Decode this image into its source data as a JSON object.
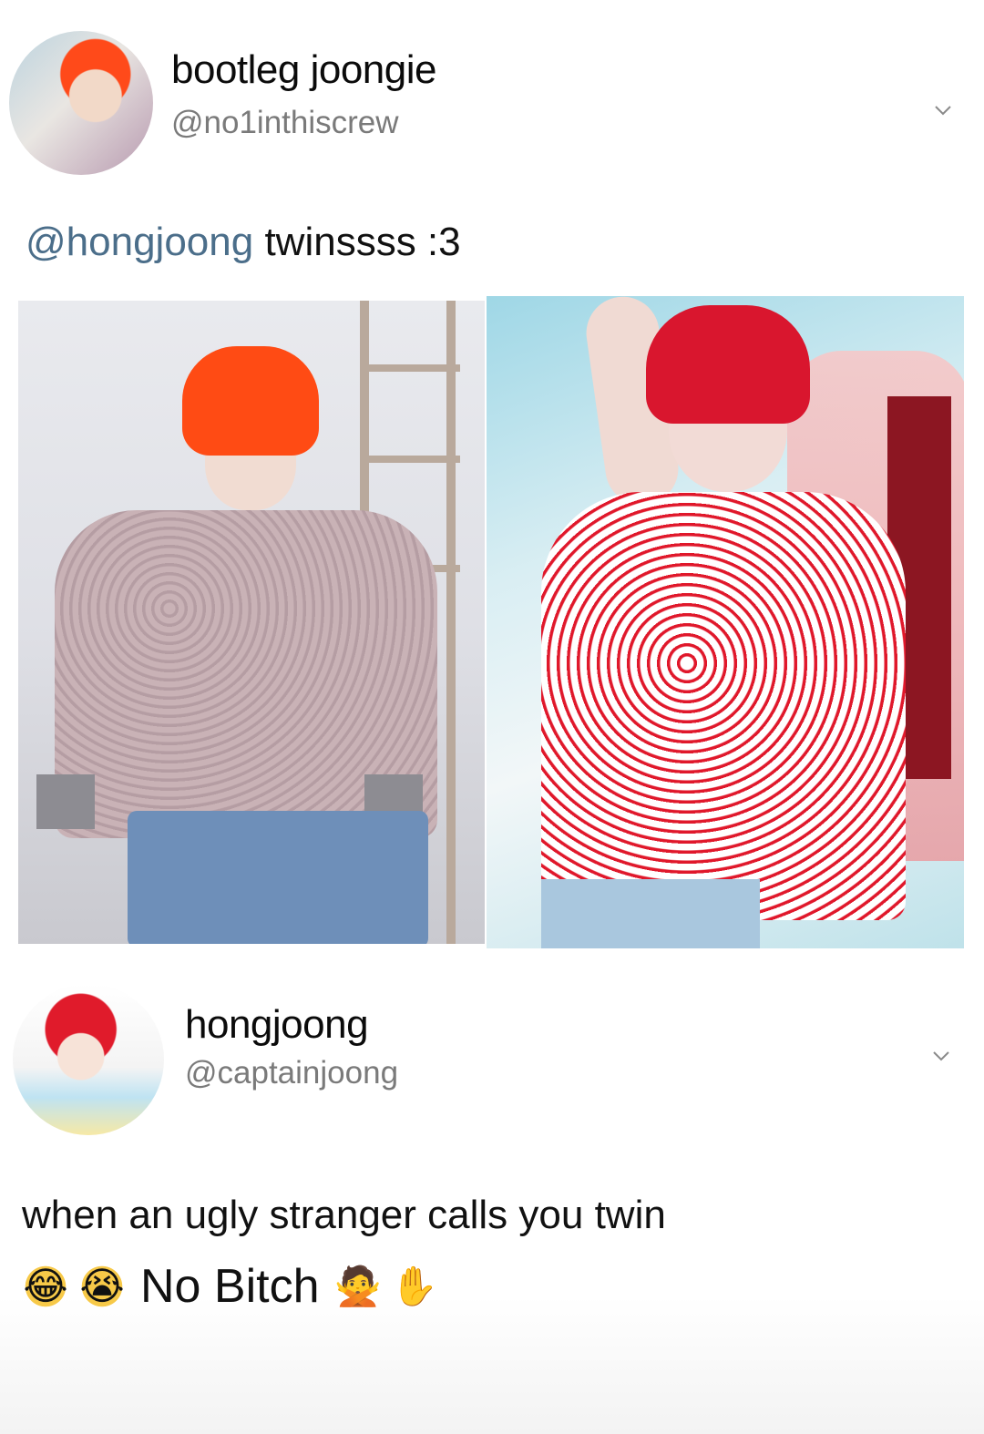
{
  "tweet1": {
    "display_name": "bootleg joongie",
    "handle": "@no1inthiscrew",
    "mention": "@hongjoong",
    "text_after_mention": " twinssss :3"
  },
  "tweet2": {
    "display_name": "hongjoong",
    "handle": "@captainjoong",
    "text_line1": "when an ugly stranger calls you twin",
    "text_line2": "No Bitch",
    "emojis_before": [
      "😂",
      "😭"
    ],
    "emojis_after": [
      "🙅",
      "✋"
    ]
  },
  "icons": {
    "chevron": "chevron-down-icon"
  },
  "colors": {
    "mention": "#4b6e8a",
    "handle": "#7a7a7a"
  }
}
